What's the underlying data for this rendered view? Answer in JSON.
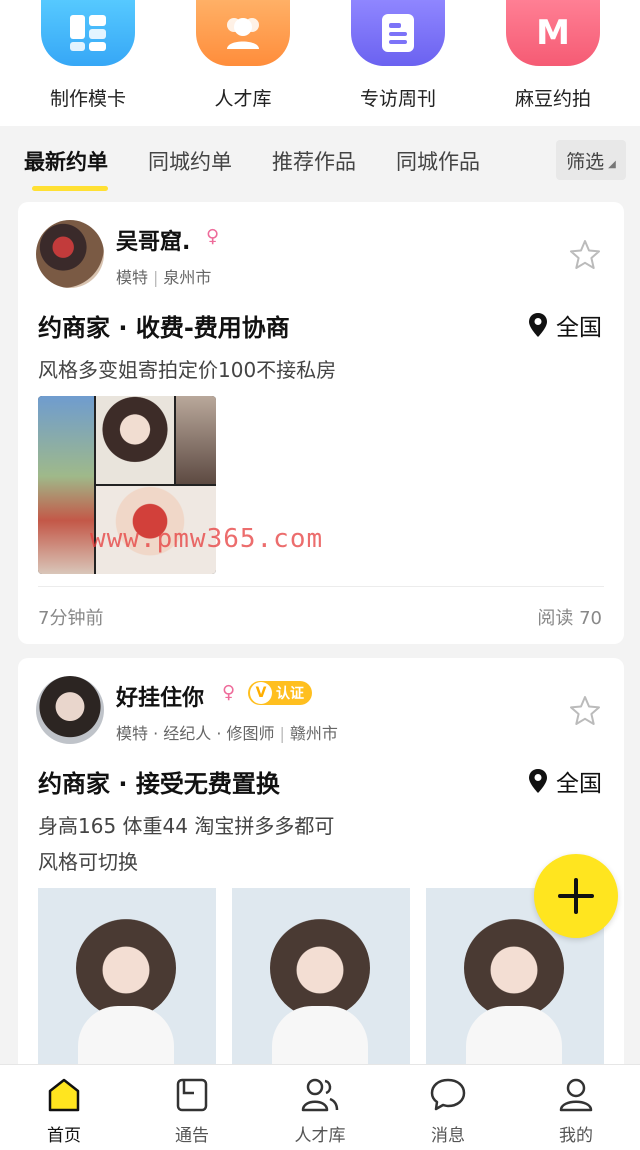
{
  "quick_links": [
    {
      "label": "制作模卡",
      "icon": "grid-icon",
      "color": "#44b8ff"
    },
    {
      "label": "人才库",
      "icon": "people-icon",
      "color": "#ff9b4a"
    },
    {
      "label": "专访周刊",
      "icon": "document-icon",
      "color": "#7c73f8"
    },
    {
      "label": "麻豆约拍",
      "icon": "m-letter-icon",
      "color": "#f7677f",
      "letter": "M"
    }
  ],
  "tabs": [
    {
      "label": "最新约单",
      "active": true
    },
    {
      "label": "同城约单"
    },
    {
      "label": "推荐作品"
    },
    {
      "label": "同城作品"
    }
  ],
  "filter": {
    "label": "筛选"
  },
  "posts": [
    {
      "username": "吴哥窟.",
      "gender": "♀",
      "roles": [
        "模特"
      ],
      "city": "泉州市",
      "title": "约商家 · 收费-费用协商",
      "location": "全国",
      "description": [
        "风格多变姐寄拍定价100不接私房"
      ],
      "time": "7分钟前",
      "reads": "阅读 70"
    },
    {
      "username": "好挂住你",
      "gender": "♀",
      "verified_letter": "V",
      "verified_label": "认证",
      "roles": [
        "模特 · 经纪人 · 修图师"
      ],
      "city": "赣州市",
      "title": "约商家 · 接受无费置换",
      "location": "全国",
      "description": [
        "身高165 体重44 淘宝拼多多都可",
        "风格可切换"
      ]
    }
  ],
  "watermark": "www.pmw365.com",
  "nav": [
    {
      "label": "首页",
      "icon": "home-icon",
      "active": true
    },
    {
      "label": "通告",
      "icon": "notice-icon"
    },
    {
      "label": "人才库",
      "icon": "talent-icon"
    },
    {
      "label": "消息",
      "icon": "message-icon"
    },
    {
      "label": "我的",
      "icon": "profile-icon"
    }
  ],
  "colors": {
    "accent": "#ffe51f",
    "badge": "#ffbf1f",
    "female": "#ee6b9a"
  }
}
